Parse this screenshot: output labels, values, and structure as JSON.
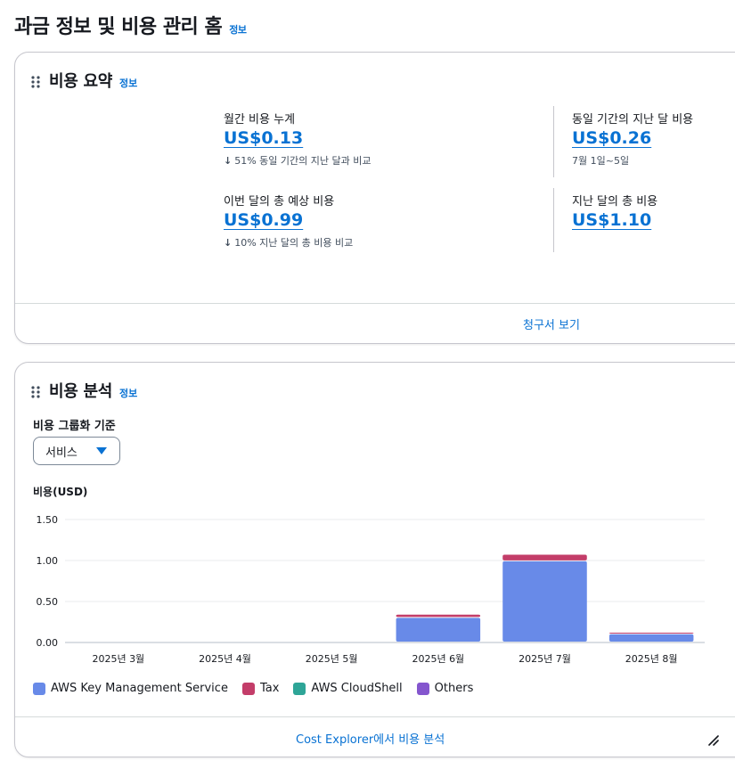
{
  "page": {
    "title": "과금 정보 및 비용 관리 홈",
    "info": "정보"
  },
  "summary": {
    "title": "비용 요약",
    "info": "정보",
    "mtd": {
      "label": "월간 비용 누계",
      "value": "US$0.13",
      "sub": "51% 동일 기간의 지난 달과 비교"
    },
    "last_same": {
      "label": "동일 기간의 지난 달 비용",
      "value": "US$0.26",
      "sub": "7월 1일~5일"
    },
    "forecast": {
      "label": "이번 달의 총 예상 비용",
      "value": "US$0.99",
      "sub": "10% 지난 달의 총 비용 비교"
    },
    "last_total": {
      "label": "지난 달의 총 비용",
      "value": "US$1.10"
    },
    "footer_link": "청구서 보기"
  },
  "analysis": {
    "title": "비용 분석",
    "info": "정보",
    "group_label": "비용 그룹화 기준",
    "group_value": "서비스",
    "footer_link": "Cost Explorer에서 비용 분석"
  },
  "icons": {
    "drag": "drag-handle-icon",
    "caret": "caret-down-icon",
    "arrow": "arrow-down-icon",
    "resize": "resize-handle-icon"
  },
  "chart_data": {
    "type": "bar",
    "ylabel": "비용(USD)",
    "ylim": [
      0,
      1.5
    ],
    "yticks": [
      "0.00",
      "0.50",
      "1.00",
      "1.50"
    ],
    "categories": [
      "2025년 3월",
      "2025년 4월",
      "2025년 5월",
      "2025년 6월",
      "2025년 7월",
      "2025년 8월"
    ],
    "stacked": true,
    "grid": true,
    "legend_position": "bottom-left",
    "series": [
      {
        "name": "AWS Key Management Service",
        "color": "#688ae8",
        "values": [
          0,
          0,
          0,
          0.3,
          0.99,
          0.1
        ]
      },
      {
        "name": "Tax",
        "color": "#c33d69",
        "values": [
          0,
          0,
          0,
          0.04,
          0.08,
          0.02
        ]
      },
      {
        "name": "AWS CloudShell",
        "color": "#2ea597",
        "values": [
          0,
          0,
          0,
          0,
          0,
          0
        ]
      },
      {
        "name": "Others",
        "color": "#8456ce",
        "values": [
          0,
          0,
          0,
          0,
          0,
          0
        ]
      }
    ]
  }
}
